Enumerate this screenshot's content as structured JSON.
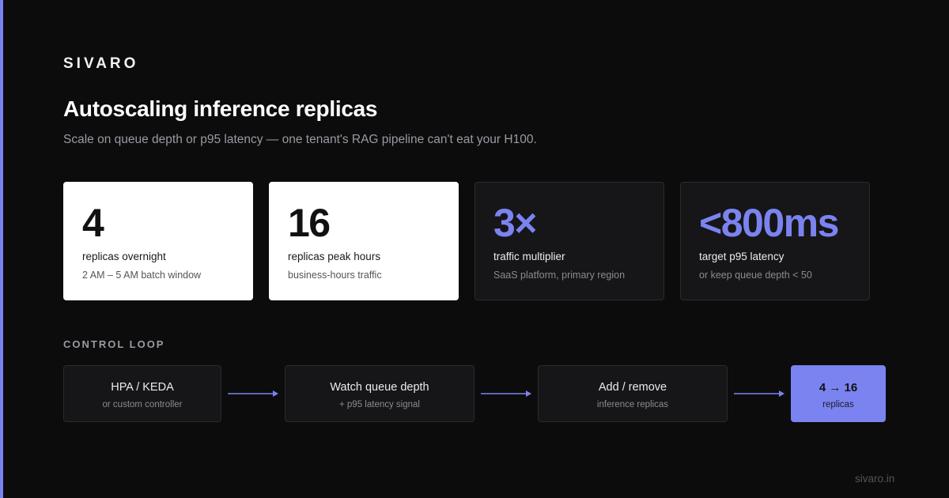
{
  "colors": {
    "background": "#0c0c0d",
    "accent": "#7b83f0",
    "card_light": "#ffffff",
    "card_dark": "#161618",
    "muted_text": "#9a9aa2"
  },
  "brand": "SIVARO",
  "title": "Autoscaling inference replicas",
  "subtitle": "Scale on queue depth or p95 latency — one tenant's RAG pipeline can't eat your H100.",
  "stats": [
    {
      "value": "4",
      "label": "replicas overnight",
      "sub": "2 AM – 5 AM batch window"
    },
    {
      "value": "16",
      "label": "replicas peak hours",
      "sub": "business-hours traffic"
    },
    {
      "value": "3×",
      "label": "traffic multiplier",
      "sub": "SaaS platform, primary region"
    },
    {
      "value": "<800ms",
      "label": "target p95 latency",
      "sub": "or keep queue depth < 50"
    }
  ],
  "control_loop": {
    "heading": "CONTROL LOOP",
    "steps": [
      {
        "title": "HPA / KEDA",
        "sub": "or custom controller"
      },
      {
        "title": "Watch queue depth",
        "sub": "+ p95 latency signal"
      },
      {
        "title": "Add / remove",
        "sub": "inference replicas"
      },
      {
        "title": "4 → 16",
        "sub": "replicas"
      }
    ],
    "arrow_icon": "arrow-right-icon"
  },
  "footer": "sivaro.in"
}
